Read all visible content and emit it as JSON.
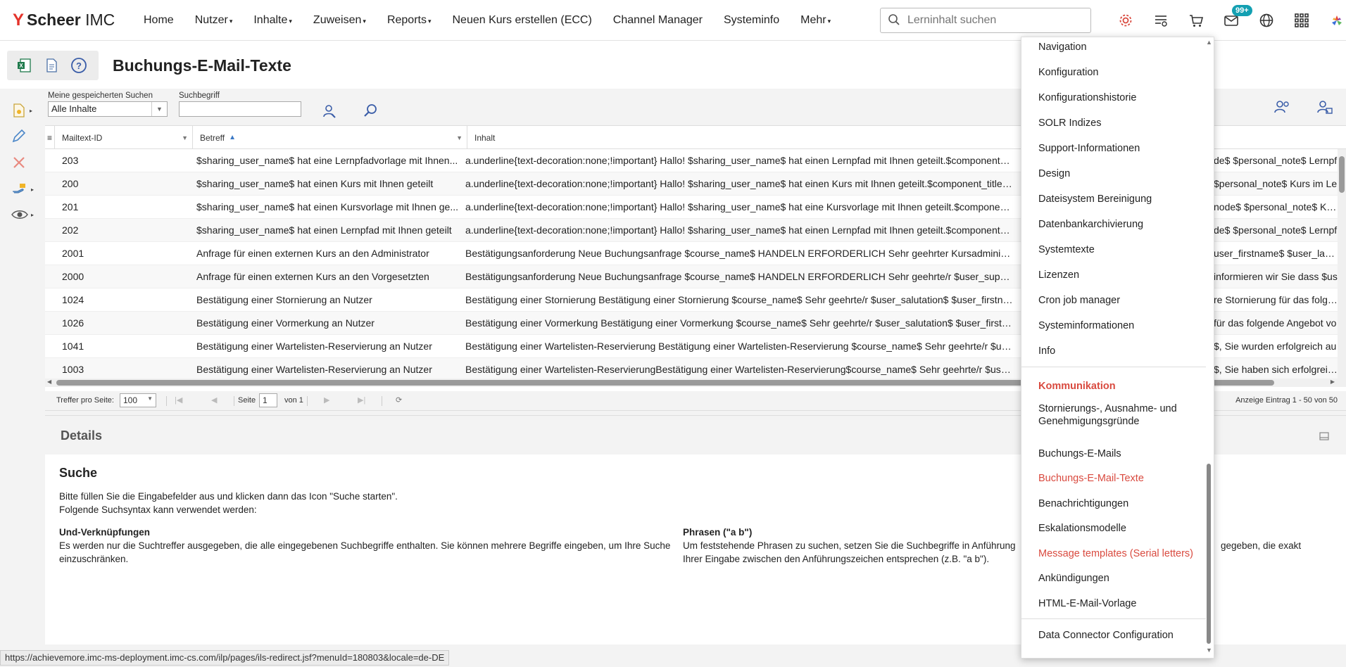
{
  "brand": {
    "mark": "Y",
    "name_bold": "Scheer",
    "name_light": " IMC"
  },
  "nav": [
    {
      "label": "Home",
      "caret": ""
    },
    {
      "label": "Nutzer",
      "caret": "▾"
    },
    {
      "label": "Inhalte",
      "caret": "▾"
    },
    {
      "label": "Zuweisen",
      "caret": "▾"
    },
    {
      "label": "Reports",
      "caret": "▾"
    },
    {
      "label": "Neuen Kurs erstellen (ECC)",
      "caret": ""
    },
    {
      "label": "Channel Manager",
      "caret": ""
    },
    {
      "label": "Systeminfo",
      "caret": ""
    },
    {
      "label": "Mehr",
      "caret": "▾"
    }
  ],
  "search": {
    "placeholder": "Lerninhalt suchen"
  },
  "notifications": {
    "badge": "99+"
  },
  "page": {
    "title": "Buchungs-E-Mail-Texte"
  },
  "filters": {
    "saved_label": "Meine gespeicherten Suchen",
    "saved_value": "Alle Inhalte",
    "term_label": "Suchbegriff",
    "term_value": ""
  },
  "grid": {
    "columns": [
      "Mailtext-ID",
      "Betreff",
      "Inhalt"
    ],
    "rows": [
      {
        "id": "203",
        "subject": "$sharing_user_name$ hat eine Lernpfadvorlage mit Ihnen...",
        "content": "a.underline{text-decoration:none;!important} Hallo! $sharing_user_name$ hat einen Lernpfad mit Ihnen geteilt.$component_title",
        "tail": "de$ $personal_note$ Lernpf"
      },
      {
        "id": "200",
        "subject": "$sharing_user_name$ hat einen Kurs mit Ihnen geteilt",
        "content": "a.underline{text-decoration:none;!important} Hallo! $sharing_user_name$ hat einen Kurs mit Ihnen geteilt.$component_title$$co",
        "tail": "$personal_note$ Kurs im Le"
      },
      {
        "id": "201",
        "subject": "$sharing_user_name$ hat einen Kursvorlage mit Ihnen ge...",
        "content": "a.underline{text-decoration:none;!important} Hallo! $sharing_user_name$ hat eine Kursvorlage mit Ihnen geteilt.$component_title",
        "tail": "node$ $personal_note$ Kurs"
      },
      {
        "id": "202",
        "subject": "$sharing_user_name$ hat einen Lernpfad mit Ihnen geteilt",
        "content": "a.underline{text-decoration:none;!important} Hallo! $sharing_user_name$ hat einen Lernpfad mit Ihnen geteilt.$component_title",
        "tail": "de$ $personal_note$ Lernpf"
      },
      {
        "id": "2001",
        "subject": "Anfrage für einen externen Kurs an den Administrator",
        "content": "Bestätigungsanforderung Neue Buchungsanfrage $course_name$ HANDELN ERFORDERLICH Sehr geehrter Kursadministrator, V",
        "tail": "user_firstname$ $user_lastn"
      },
      {
        "id": "2000",
        "subject": "Anfrage für einen externen Kurs an den Vorgesetzten",
        "content": "Bestätigungsanforderung Neue Buchungsanfrage $course_name$ HANDELN ERFORDERLICH Sehr geehrte/r $user_superior_firs",
        "tail": "informieren wir Sie dass $us"
      },
      {
        "id": "1024",
        "subject": "Bestätigung einer Stornierung an Nutzer",
        "content": "Bestätigung einer Stornierung Bestätigung einer Stornierung $course_name$ Sehr geehrte/r $user_salutation$ $user_firstname$",
        "tail": "re Stornierung für das folgen"
      },
      {
        "id": "1026",
        "subject": "Bestätigung einer Vormerkung an Nutzer",
        "content": "Bestätigung einer Vormerkung Bestätigung einer Vormerkung $course_name$ Sehr geehrte/r $user_salutation$ $user_firstname",
        "tail": "für das folgende Angebot vo"
      },
      {
        "id": "1041",
        "subject": "Bestätigung einer Wartelisten-Reservierung an Nutzer",
        "content": "Bestätigung einer Wartelisten-Reservierung Bestätigung einer Wartelisten-Reservierung $course_name$ Sehr geehrte/r $user_sa",
        "tail": "$, Sie wurden erfolgreich au"
      },
      {
        "id": "1003",
        "subject": "Bestätigung einer Wartelisten-Reservierung an Nutzer",
        "content": "Bestätigung einer Wartelisten-ReservierungBestätigung einer Wartelisten-Reservierung$course_name$ Sehr geehrte/r $user_sa",
        "tail": "$, Sie haben sich erfolgreich"
      }
    ]
  },
  "pager": {
    "per_page_label": "Treffer pro Seite:",
    "per_page_value": "100",
    "page_label": "Seite",
    "page_value": "1",
    "of_label": "von 1",
    "summary": "Anzeige Eintrag 1 - 50 von 50"
  },
  "details": {
    "header": "Details",
    "title": "Suche",
    "intro_line1": "Bitte füllen Sie die Eingabefelder aus und klicken dann das Icon \"Suche starten\".",
    "intro_line2": "Folgende Suchsyntax kann verwendet werden:",
    "and_title": "Und-Verknüpfungen",
    "and_text": "Es werden nur die Suchtreffer ausgegeben, die alle eingegebenen Suchbegriffe enthalten. Sie können mehrere Begriffe eingeben, um Ihre Suche einzuschränken.",
    "phrase_title": "Phrasen (\"a b\")",
    "phrase_text_1": "Um feststehende Phrasen zu suchen, setzen Sie die Suchbegriffe in Anführung",
    "phrase_text_1b": "gegeben, die exakt",
    "phrase_text_2": "Ihrer Eingabe zwischen den Anführungszeichen entsprechen (z.B. \"a b\")."
  },
  "menu": {
    "items_top": [
      "Navigation",
      "Konfiguration",
      "Konfigurationshistorie",
      "SOLR Indizes",
      "Support-Informationen",
      "Design",
      "Dateisystem Bereinigung",
      "Datenbankarchivierung",
      "Systemtexte",
      "Lizenzen",
      "Cron job manager",
      "Systeminformationen",
      "Info"
    ],
    "section": "Kommunikation",
    "items_comm": [
      {
        "label": "Stornierungs-, Ausnahme- und",
        "label2": "Genehmigungsgründe",
        "state": ""
      },
      {
        "label": "Buchungs-E-Mails",
        "label2": "",
        "state": ""
      },
      {
        "label": "Buchungs-E-Mail-Texte",
        "label2": "",
        "state": "active"
      },
      {
        "label": "Benachrichtigungen",
        "label2": "",
        "state": ""
      },
      {
        "label": "Eskalationsmodelle",
        "label2": "",
        "state": ""
      },
      {
        "label": "Message templates (Serial letters)",
        "label2": "",
        "state": "active"
      },
      {
        "label": "Ankündigungen",
        "label2": "",
        "state": ""
      },
      {
        "label": "HTML-E-Mail-Vorlage",
        "label2": "",
        "state": ""
      }
    ],
    "bottom": "Data Connector Configuration"
  },
  "status_url": "https://achievemore.imc-ms-deployment.imc-cs.com/ilp/pages/ils-redirect.jsf?menuId=180803&locale=de-DE",
  "colors": {
    "brand": "#e4332b",
    "accent": "#d94a3f",
    "badge": "#13a0b2",
    "link_blue": "#3a78c5"
  }
}
